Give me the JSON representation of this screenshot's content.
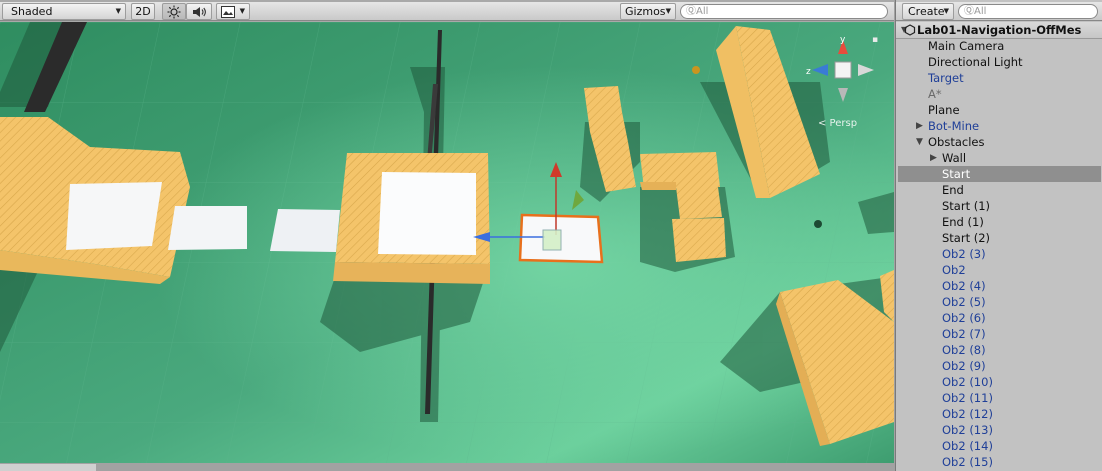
{
  "scene_view": {
    "toolbar": {
      "shading_mode": "Shaded",
      "mode_2d": "2D",
      "gizmos_label": "Gizmos",
      "search_placeholder": "ⓆAll"
    },
    "gizmo": {
      "x_label": "x",
      "y_label": "y",
      "z_label": "z",
      "projection_label": "< Persp"
    }
  },
  "hierarchy": {
    "create_label": "Create",
    "search_placeholder": "ⓆAll",
    "scene_name": "Lab01-Navigation-OffMes",
    "items": [
      {
        "label": "Main Camera",
        "style": "normal",
        "depth": 0,
        "fold": ""
      },
      {
        "label": "Directional Light",
        "style": "normal",
        "depth": 0,
        "fold": ""
      },
      {
        "label": "Target",
        "style": "blue",
        "depth": 0,
        "fold": ""
      },
      {
        "label": "A*",
        "style": "disabled",
        "depth": 0,
        "fold": ""
      },
      {
        "label": "Plane",
        "style": "normal",
        "depth": 0,
        "fold": ""
      },
      {
        "label": "Bot-Mine",
        "style": "blue",
        "depth": 0,
        "fold": "collapsed"
      },
      {
        "label": "Obstacles",
        "style": "normal",
        "depth": 0,
        "fold": "expanded"
      },
      {
        "label": "Wall",
        "style": "normal",
        "depth": 1,
        "fold": "collapsed"
      },
      {
        "label": "Start",
        "style": "selected",
        "depth": 1,
        "fold": ""
      },
      {
        "label": "End",
        "style": "normal",
        "depth": 1,
        "fold": ""
      },
      {
        "label": "Start (1)",
        "style": "normal",
        "depth": 1,
        "fold": ""
      },
      {
        "label": "End (1)",
        "style": "normal",
        "depth": 1,
        "fold": ""
      },
      {
        "label": "Start (2)",
        "style": "normal",
        "depth": 1,
        "fold": ""
      },
      {
        "label": "Ob2 (3)",
        "style": "blue",
        "depth": 1,
        "fold": ""
      },
      {
        "label": "Ob2",
        "style": "blue",
        "depth": 1,
        "fold": ""
      },
      {
        "label": "Ob2 (4)",
        "style": "blue",
        "depth": 1,
        "fold": ""
      },
      {
        "label": "Ob2 (5)",
        "style": "blue",
        "depth": 1,
        "fold": ""
      },
      {
        "label": "Ob2 (6)",
        "style": "blue",
        "depth": 1,
        "fold": ""
      },
      {
        "label": "Ob2 (7)",
        "style": "blue",
        "depth": 1,
        "fold": ""
      },
      {
        "label": "Ob2 (8)",
        "style": "blue",
        "depth": 1,
        "fold": ""
      },
      {
        "label": "Ob2 (9)",
        "style": "blue",
        "depth": 1,
        "fold": ""
      },
      {
        "label": "Ob2 (10)",
        "style": "blue",
        "depth": 1,
        "fold": ""
      },
      {
        "label": "Ob2 (11)",
        "style": "blue",
        "depth": 1,
        "fold": ""
      },
      {
        "label": "Ob2 (12)",
        "style": "blue",
        "depth": 1,
        "fold": ""
      },
      {
        "label": "Ob2 (13)",
        "style": "blue",
        "depth": 1,
        "fold": ""
      },
      {
        "label": "Ob2 (14)",
        "style": "blue",
        "depth": 1,
        "fold": ""
      },
      {
        "label": "Ob2 (15)",
        "style": "blue",
        "depth": 1,
        "fold": ""
      }
    ]
  },
  "colors": {
    "ground": "#3f9c74",
    "obstacle": "#f2c46a",
    "selection_outline": "#e8701c",
    "prefab_blue": "#1f3f98",
    "selected_row": "#8f8f8f"
  }
}
